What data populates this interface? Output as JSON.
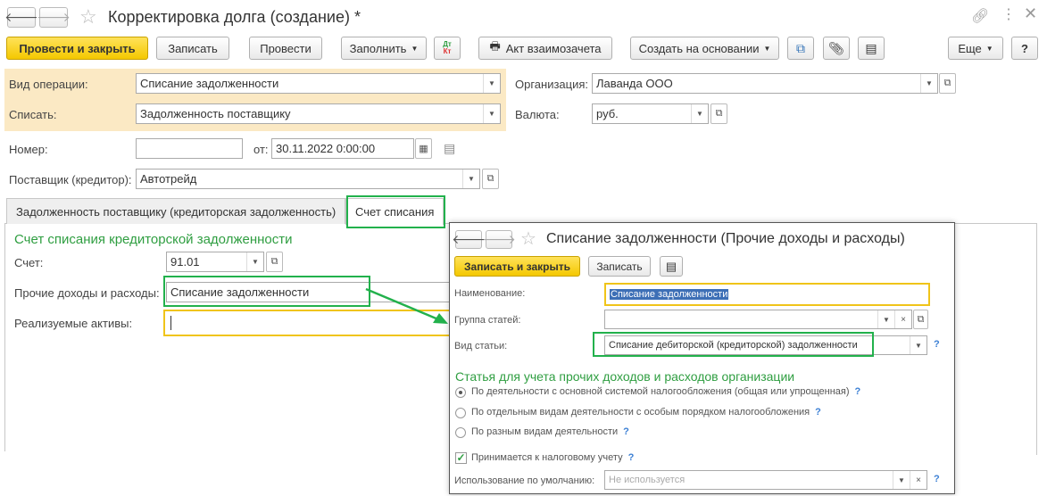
{
  "window": {
    "title": "Корректировка долга (создание) *",
    "nav_back": "🡐",
    "nav_forward": "🡒"
  },
  "toolbar": {
    "post_close": "Провести и закрыть",
    "save": "Записать",
    "post": "Провести",
    "fill": "Заполнить",
    "dt_kt_top": "Дт",
    "dt_kt_bottom": "Кт",
    "act": "Акт взаимозачета",
    "create_based": "Создать на основании",
    "more": "Еще",
    "help": "?"
  },
  "form": {
    "op_type_label": "Вид операции:",
    "op_type_value": "Списание задолженности",
    "write_off_label": "Списать:",
    "write_off_value": "Задолженность поставщику",
    "org_label": "Организация:",
    "org_value": "Лаванда ООО",
    "currency_label": "Валюта:",
    "currency_value": "руб.",
    "number_label": "Номер:",
    "number_value": "",
    "date_label": "от:",
    "date_value": "30.11.2022  0:00:00",
    "supplier_label": "Поставщик (кредитор):",
    "supplier_value": "Автотрейд"
  },
  "tabs": [
    {
      "label": "Задолженность поставщику (кредиторская задолженность)"
    },
    {
      "label": "Счет списания"
    }
  ],
  "account_section": {
    "title": "Счет списания кредиторской задолженности",
    "account_label": "Счет:",
    "account_value": "91.01",
    "other_label": "Прочие доходы и расходы:",
    "other_value": "Списание задолженности",
    "assets_label": "Реализуемые активы:",
    "assets_value": ""
  },
  "dialog": {
    "title": "Списание задолженности (Прочие доходы и расходы)",
    "save_close": "Записать и закрыть",
    "save": "Записать",
    "name_label": "Наименование:",
    "name_value": "Списание задолженности",
    "group_label": "Группа статей:",
    "group_value": "",
    "kind_label": "Вид статьи:",
    "kind_value": "Списание дебиторской (кредиторской) задолженности",
    "section_title": "Статья для учета прочих доходов и расходов организации",
    "radios": [
      {
        "label": "По деятельности с основной системой налогообложения (общая или упрощенная)",
        "checked": true
      },
      {
        "label": "По отдельным видам деятельности с особым порядком налогообложения",
        "checked": false
      },
      {
        "label": "По разным видам деятельности",
        "checked": false
      }
    ],
    "tax_label": "Принимается к налоговому учету",
    "tax_checked": true,
    "default_label": "Использование по умолчанию:",
    "default_placeholder": "Не используется",
    "question": "?"
  }
}
